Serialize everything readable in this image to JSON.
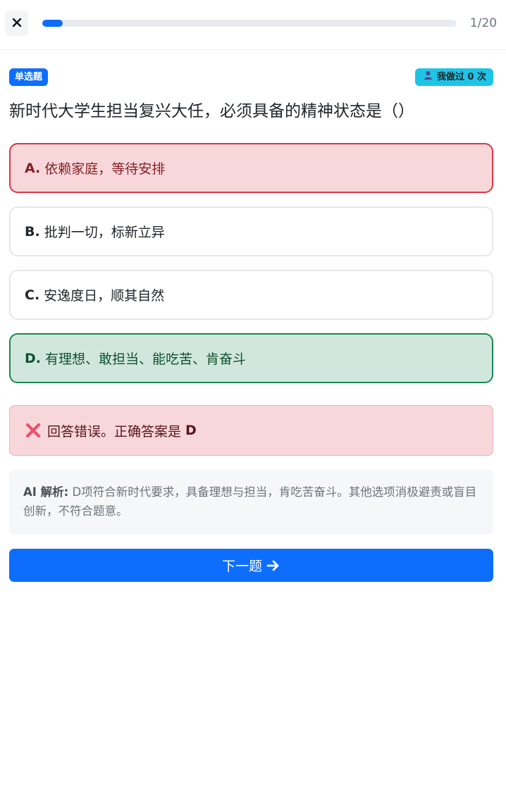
{
  "header": {
    "close_icon": "close-icon",
    "progress_fraction": 0.05,
    "progress_color": "#0d6efd",
    "counter": "1/20"
  },
  "question": {
    "type_badge": "单选题",
    "attempts_icon": "user-icon",
    "attempts_label": "我做过 0 次",
    "text": "新时代大学生担当复兴大任，必须具备的精神状态是（）"
  },
  "options": [
    {
      "letter": "A.",
      "text": "依赖家庭，等待安排",
      "state": "wrong"
    },
    {
      "letter": "B.",
      "text": "批判一切，标新立异",
      "state": "default"
    },
    {
      "letter": "C.",
      "text": "安逸度日，顺其自然",
      "state": "default"
    },
    {
      "letter": "D.",
      "text": "有理想、敢担当、能吃苦、肯奋斗",
      "state": "correct"
    }
  ],
  "feedback": {
    "icon": "cross-mark-icon",
    "text": "回答错误。正确答案是",
    "answer": "D"
  },
  "analysis": {
    "label": "AI 解析:",
    "text": "D项符合新时代要求，具备理想与担当，肯吃苦奋斗。其他选项消极避责或盲目创新，不符合题意。"
  },
  "next_button": {
    "label": "下一题",
    "icon": "arrow-right-icon"
  },
  "colors": {
    "primary": "#0d6efd",
    "wrong_bg": "#f8d7da",
    "wrong_border": "#dc3545",
    "correct_bg": "#d1e7dd",
    "correct_border": "#198754",
    "attempts_badge": "#1ec4e6"
  }
}
